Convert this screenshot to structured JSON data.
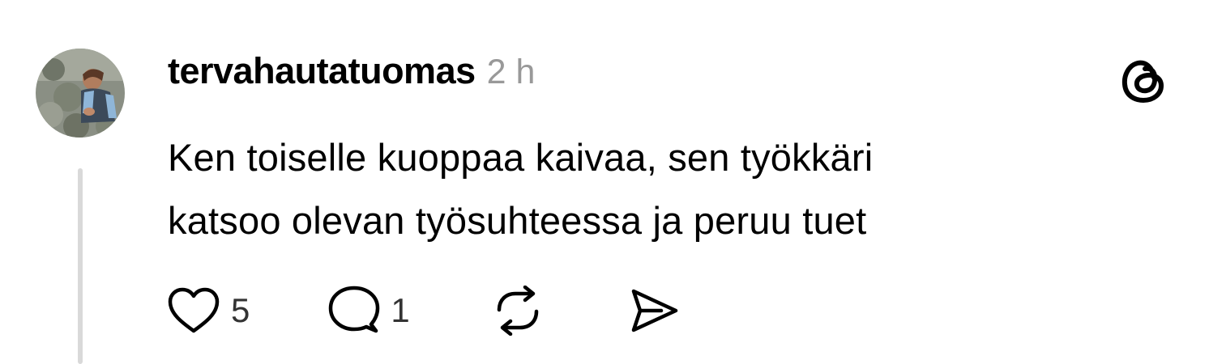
{
  "post": {
    "username": "tervahautatuomas",
    "timestamp": "2 h",
    "text_lines": [
      "Ken toiselle kuoppaa kaivaa, sen työkkäri",
      "katsoo olevan työsuhteessa ja peruu tuet"
    ],
    "avatar": "user-avatar-photo"
  },
  "actions": {
    "like": {
      "icon": "heart-icon",
      "count": "5"
    },
    "reply": {
      "icon": "comment-icon",
      "count": "1"
    },
    "repost": {
      "icon": "repost-icon"
    },
    "share": {
      "icon": "send-icon"
    }
  },
  "brand": {
    "icon": "threads-logo-icon"
  },
  "colors": {
    "text": "#000000",
    "muted": "#999999",
    "thread_line": "#d9d9d9",
    "background": "#ffffff"
  }
}
